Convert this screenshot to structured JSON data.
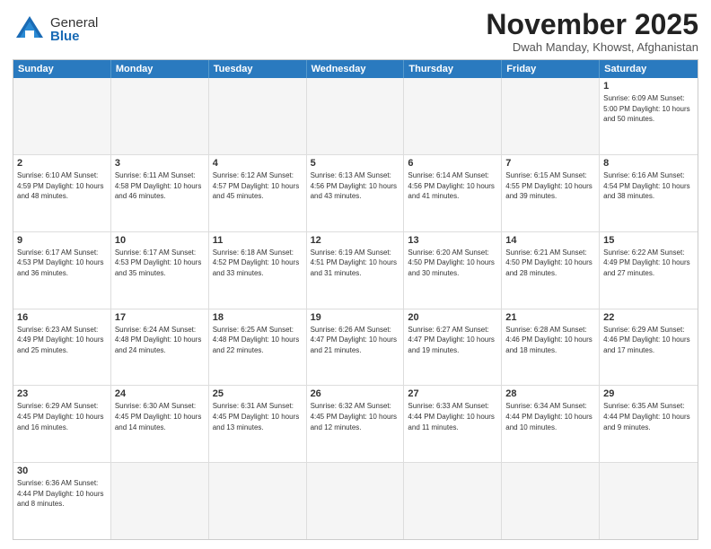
{
  "header": {
    "logo_general": "General",
    "logo_blue": "Blue",
    "month_title": "November 2025",
    "location": "Dwah Manday, Khowst, Afghanistan"
  },
  "weekdays": [
    "Sunday",
    "Monday",
    "Tuesday",
    "Wednesday",
    "Thursday",
    "Friday",
    "Saturday"
  ],
  "weeks": [
    [
      {
        "day": "",
        "info": ""
      },
      {
        "day": "",
        "info": ""
      },
      {
        "day": "",
        "info": ""
      },
      {
        "day": "",
        "info": ""
      },
      {
        "day": "",
        "info": ""
      },
      {
        "day": "",
        "info": ""
      },
      {
        "day": "1",
        "info": "Sunrise: 6:09 AM\nSunset: 5:00 PM\nDaylight: 10 hours and 50 minutes."
      }
    ],
    [
      {
        "day": "2",
        "info": "Sunrise: 6:10 AM\nSunset: 4:59 PM\nDaylight: 10 hours and 48 minutes."
      },
      {
        "day": "3",
        "info": "Sunrise: 6:11 AM\nSunset: 4:58 PM\nDaylight: 10 hours and 46 minutes."
      },
      {
        "day": "4",
        "info": "Sunrise: 6:12 AM\nSunset: 4:57 PM\nDaylight: 10 hours and 45 minutes."
      },
      {
        "day": "5",
        "info": "Sunrise: 6:13 AM\nSunset: 4:56 PM\nDaylight: 10 hours and 43 minutes."
      },
      {
        "day": "6",
        "info": "Sunrise: 6:14 AM\nSunset: 4:56 PM\nDaylight: 10 hours and 41 minutes."
      },
      {
        "day": "7",
        "info": "Sunrise: 6:15 AM\nSunset: 4:55 PM\nDaylight: 10 hours and 39 minutes."
      },
      {
        "day": "8",
        "info": "Sunrise: 6:16 AM\nSunset: 4:54 PM\nDaylight: 10 hours and 38 minutes."
      }
    ],
    [
      {
        "day": "9",
        "info": "Sunrise: 6:17 AM\nSunset: 4:53 PM\nDaylight: 10 hours and 36 minutes."
      },
      {
        "day": "10",
        "info": "Sunrise: 6:17 AM\nSunset: 4:53 PM\nDaylight: 10 hours and 35 minutes."
      },
      {
        "day": "11",
        "info": "Sunrise: 6:18 AM\nSunset: 4:52 PM\nDaylight: 10 hours and 33 minutes."
      },
      {
        "day": "12",
        "info": "Sunrise: 6:19 AM\nSunset: 4:51 PM\nDaylight: 10 hours and 31 minutes."
      },
      {
        "day": "13",
        "info": "Sunrise: 6:20 AM\nSunset: 4:50 PM\nDaylight: 10 hours and 30 minutes."
      },
      {
        "day": "14",
        "info": "Sunrise: 6:21 AM\nSunset: 4:50 PM\nDaylight: 10 hours and 28 minutes."
      },
      {
        "day": "15",
        "info": "Sunrise: 6:22 AM\nSunset: 4:49 PM\nDaylight: 10 hours and 27 minutes."
      }
    ],
    [
      {
        "day": "16",
        "info": "Sunrise: 6:23 AM\nSunset: 4:49 PM\nDaylight: 10 hours and 25 minutes."
      },
      {
        "day": "17",
        "info": "Sunrise: 6:24 AM\nSunset: 4:48 PM\nDaylight: 10 hours and 24 minutes."
      },
      {
        "day": "18",
        "info": "Sunrise: 6:25 AM\nSunset: 4:48 PM\nDaylight: 10 hours and 22 minutes."
      },
      {
        "day": "19",
        "info": "Sunrise: 6:26 AM\nSunset: 4:47 PM\nDaylight: 10 hours and 21 minutes."
      },
      {
        "day": "20",
        "info": "Sunrise: 6:27 AM\nSunset: 4:47 PM\nDaylight: 10 hours and 19 minutes."
      },
      {
        "day": "21",
        "info": "Sunrise: 6:28 AM\nSunset: 4:46 PM\nDaylight: 10 hours and 18 minutes."
      },
      {
        "day": "22",
        "info": "Sunrise: 6:29 AM\nSunset: 4:46 PM\nDaylight: 10 hours and 17 minutes."
      }
    ],
    [
      {
        "day": "23",
        "info": "Sunrise: 6:29 AM\nSunset: 4:45 PM\nDaylight: 10 hours and 16 minutes."
      },
      {
        "day": "24",
        "info": "Sunrise: 6:30 AM\nSunset: 4:45 PM\nDaylight: 10 hours and 14 minutes."
      },
      {
        "day": "25",
        "info": "Sunrise: 6:31 AM\nSunset: 4:45 PM\nDaylight: 10 hours and 13 minutes."
      },
      {
        "day": "26",
        "info": "Sunrise: 6:32 AM\nSunset: 4:45 PM\nDaylight: 10 hours and 12 minutes."
      },
      {
        "day": "27",
        "info": "Sunrise: 6:33 AM\nSunset: 4:44 PM\nDaylight: 10 hours and 11 minutes."
      },
      {
        "day": "28",
        "info": "Sunrise: 6:34 AM\nSunset: 4:44 PM\nDaylight: 10 hours and 10 minutes."
      },
      {
        "day": "29",
        "info": "Sunrise: 6:35 AM\nSunset: 4:44 PM\nDaylight: 10 hours and 9 minutes."
      }
    ],
    [
      {
        "day": "30",
        "info": "Sunrise: 6:36 AM\nSunset: 4:44 PM\nDaylight: 10 hours and 8 minutes."
      },
      {
        "day": "",
        "info": ""
      },
      {
        "day": "",
        "info": ""
      },
      {
        "day": "",
        "info": ""
      },
      {
        "day": "",
        "info": ""
      },
      {
        "day": "",
        "info": ""
      },
      {
        "day": "",
        "info": ""
      }
    ]
  ]
}
